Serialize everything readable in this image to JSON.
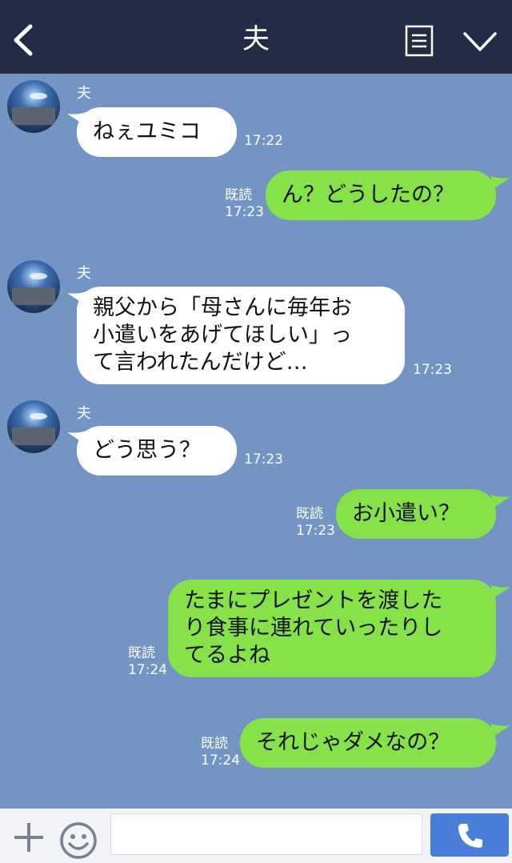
{
  "header": {
    "title": "夫"
  },
  "messages": [
    {
      "side": "in",
      "sender": "夫",
      "text": "ねぇユミコ",
      "time": "17:22"
    },
    {
      "side": "out",
      "read": "既読",
      "text": "ん？どうしたの？",
      "time": "17:23"
    },
    {
      "side": "in",
      "sender": "夫",
      "text": "親父から「母さんに毎年お\n小遣いをあげてほしい」っ\nて言われたんだけど…",
      "time": "17:23"
    },
    {
      "side": "in",
      "sender": "夫",
      "text": "どう思う？",
      "time": "17:23"
    },
    {
      "side": "out",
      "read": "既読",
      "text": "お小遣い？",
      "time": "17:23"
    },
    {
      "side": "out",
      "read": "既読",
      "text": "たまにプレゼントを渡した\nり食事に連れていったりし\nてるよね",
      "time": "17:24"
    },
    {
      "side": "out",
      "read": "既読",
      "text": "それじゃダメなの？",
      "time": "17:24"
    }
  ],
  "footer": {
    "input_placeholder": ""
  },
  "colors": {
    "header_bg": "#222d45",
    "chat_bg": "#7494c4",
    "incoming": "#ffffff",
    "outgoing": "#85e249",
    "call_button": "#4a7fd9"
  },
  "icons": [
    "back-arrow-icon",
    "menu-list-icon",
    "chevron-down-icon",
    "plus-icon",
    "emoji-icon",
    "phone-icon"
  ]
}
